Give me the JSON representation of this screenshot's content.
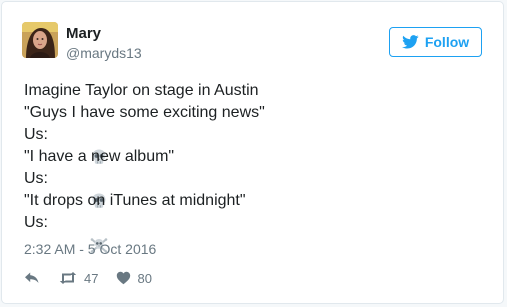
{
  "tweet": {
    "author_name": "Mary",
    "author_handle": "@maryds13",
    "follow_label": "Follow",
    "lines": [
      {
        "text": "Imagine Taylor on stage in Austin",
        "emoji": ""
      },
      {
        "text": "\"Guys I have some exciting news\"",
        "emoji": ""
      },
      {
        "text": "Us:",
        "emoji": "skull"
      },
      {
        "text": "\"I have a new album\"",
        "emoji": ""
      },
      {
        "text": "Us:",
        "emoji": "skull"
      },
      {
        "text": "\"It drops on iTunes at midnight\"",
        "emoji": ""
      },
      {
        "text": "Us:",
        "emoji": "skull-and-crossbones"
      }
    ],
    "timestamp": "2:32 AM - 5 Oct 2016",
    "retweet_count": "47",
    "like_count": "80"
  },
  "icons": {
    "follow": "twitter-bird-icon",
    "reply": "reply-icon",
    "retweet": "retweet-icon",
    "like": "heart-icon"
  },
  "colors": {
    "accent": "#1da1f2",
    "text": "#1c2022",
    "muted": "#697882",
    "border": "#e1e8ed"
  }
}
